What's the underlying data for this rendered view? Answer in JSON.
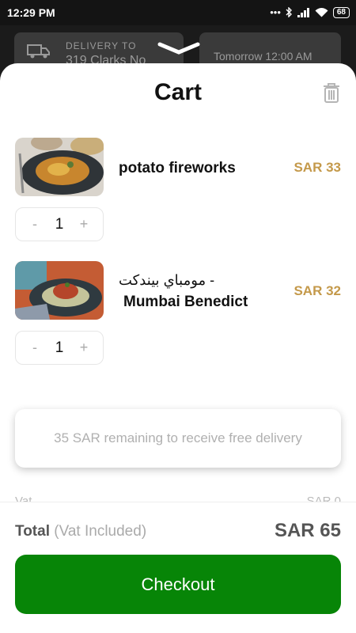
{
  "status_bar": {
    "time": "12:29 PM",
    "icons": "•••",
    "battery": "68"
  },
  "background": {
    "delivery_label": "DELIVERY TO",
    "delivery_address": "319 Clarks No",
    "time_slot": "Tomorrow 12:00 AM"
  },
  "cart": {
    "title": "Cart",
    "items": [
      {
        "name": "potato fireworks",
        "price": "SAR 33",
        "quantity": "1"
      },
      {
        "name_ar": "مومباي بيندكت -",
        "name": "Mumbai Benedict",
        "price": "SAR 32",
        "quantity": "1"
      }
    ],
    "stepper": {
      "minus": "-",
      "plus": "+"
    },
    "free_delivery_notice": "35 SAR remaining to receive free delivery",
    "vat_label": "Vat",
    "vat_value": "SAR 0",
    "total_label": "Total",
    "total_sub": "(Vat Included)",
    "total_value": "SAR 65",
    "checkout_label": "Checkout"
  },
  "colors": {
    "price": "#c4994a",
    "checkout": "#078507"
  }
}
